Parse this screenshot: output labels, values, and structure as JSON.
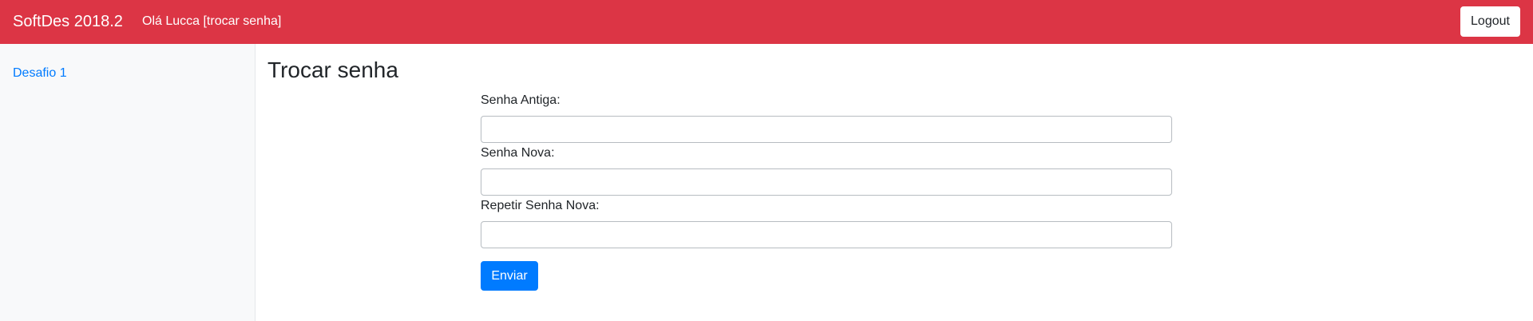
{
  "navbar": {
    "brand": "SoftDes 2018.2",
    "greeting_prefix": "Olá Lucca ",
    "change_password_link": "[trocar senha]",
    "logout_label": "Logout",
    "color": "#dc3545"
  },
  "sidebar": {
    "items": [
      {
        "label": "Desafio 1"
      }
    ]
  },
  "main": {
    "title": "Trocar senha",
    "fields": [
      {
        "label": "Senha Antiga:",
        "value": "",
        "placeholder": ""
      },
      {
        "label": "Senha Nova:",
        "value": "",
        "placeholder": ""
      },
      {
        "label": "Repetir Senha Nova:",
        "value": "",
        "placeholder": ""
      }
    ],
    "submit_label": "Enviar",
    "submit_color": "#007bff"
  }
}
